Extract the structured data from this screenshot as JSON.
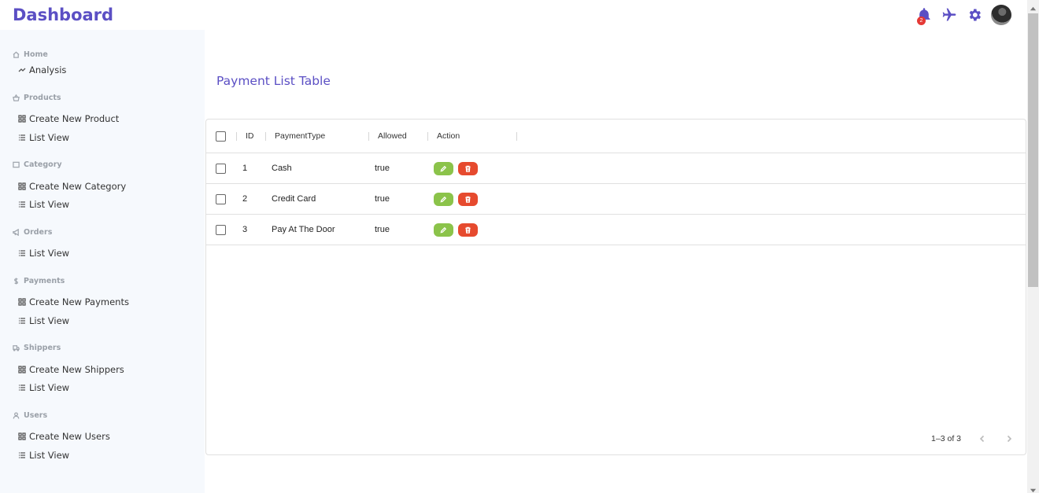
{
  "brand": "Dashboard",
  "header": {
    "notification_count": "2"
  },
  "sidebar": {
    "sections": [
      {
        "label": "Home",
        "icon": "home-icon",
        "items": [
          {
            "label": "Analysis",
            "icon": "chart-line-icon"
          }
        ]
      },
      {
        "label": "Products",
        "icon": "basket-icon",
        "items": [
          {
            "label": "Create New Product",
            "icon": "grid-icon"
          },
          {
            "label": "List View",
            "icon": "list-icon"
          }
        ]
      },
      {
        "label": "Category",
        "icon": "square-icon",
        "items": [
          {
            "label": "Create New Category",
            "icon": "grid-icon"
          },
          {
            "label": "List View",
            "icon": "list-icon"
          }
        ]
      },
      {
        "label": "Orders",
        "icon": "megaphone-icon",
        "items": [
          {
            "label": "List View",
            "icon": "list-icon"
          }
        ]
      },
      {
        "label": "Payments",
        "icon": "dollar-icon",
        "items": [
          {
            "label": "Create New Payments",
            "icon": "grid-icon"
          },
          {
            "label": "List View",
            "icon": "list-icon"
          }
        ]
      },
      {
        "label": "Shippers",
        "icon": "truck-icon",
        "items": [
          {
            "label": "Create New Shippers",
            "icon": "grid-icon"
          },
          {
            "label": "List View",
            "icon": "list-icon"
          }
        ]
      },
      {
        "label": "Users",
        "icon": "user-icon",
        "items": [
          {
            "label": "Create New Users",
            "icon": "grid-icon"
          },
          {
            "label": "List View",
            "icon": "list-icon"
          }
        ]
      }
    ]
  },
  "main": {
    "title": "Payment List Table",
    "columns": {
      "id": "ID",
      "type": "PaymentType",
      "allowed": "Allowed",
      "action": "Action"
    },
    "rows": [
      {
        "id": "1",
        "type": "Cash",
        "allowed": "true"
      },
      {
        "id": "2",
        "type": "Credit Card",
        "allowed": "true"
      },
      {
        "id": "3",
        "type": "Pay At The Door",
        "allowed": "true"
      }
    ],
    "pagination": "1–3 of 3"
  },
  "colors": {
    "accent": "#5b4fc4",
    "edit": "#8bc34a",
    "delete": "#e64a2e",
    "sidebar_bg": "#f6f9fd"
  }
}
